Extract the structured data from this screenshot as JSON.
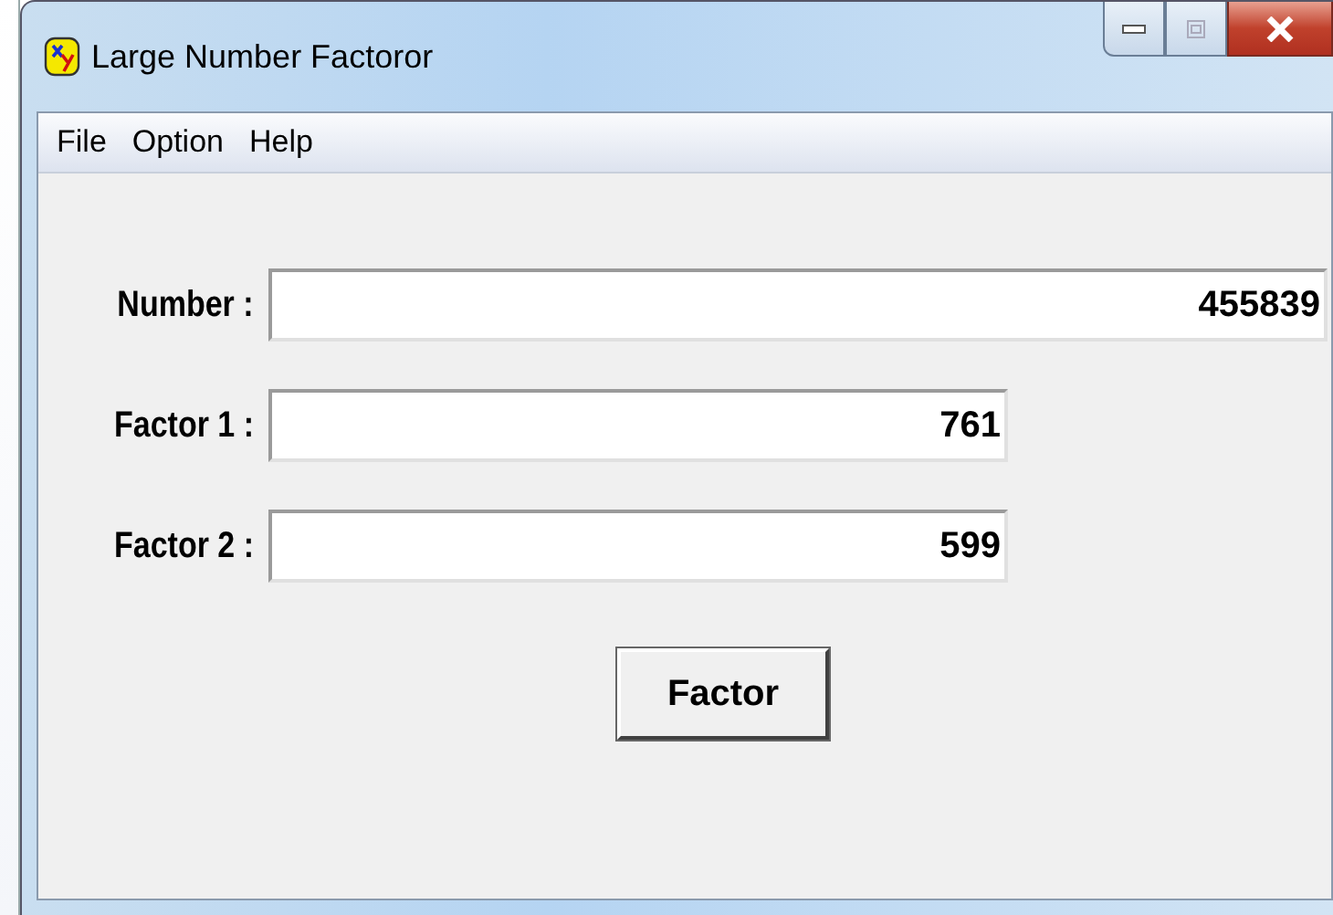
{
  "window": {
    "title": "Large Number Factoror"
  },
  "menu": [
    {
      "label": "File"
    },
    {
      "label": "Option"
    },
    {
      "label": "Help"
    }
  ],
  "fields": [
    {
      "label": "Number :",
      "value": "455839",
      "kind": "wide"
    },
    {
      "label": "Factor 1 :",
      "value": "761",
      "kind": "narrow"
    },
    {
      "label": "Factor 2 :",
      "value": "599",
      "kind": "narrow"
    }
  ],
  "buttons": [
    {
      "label": "Factor"
    }
  ]
}
